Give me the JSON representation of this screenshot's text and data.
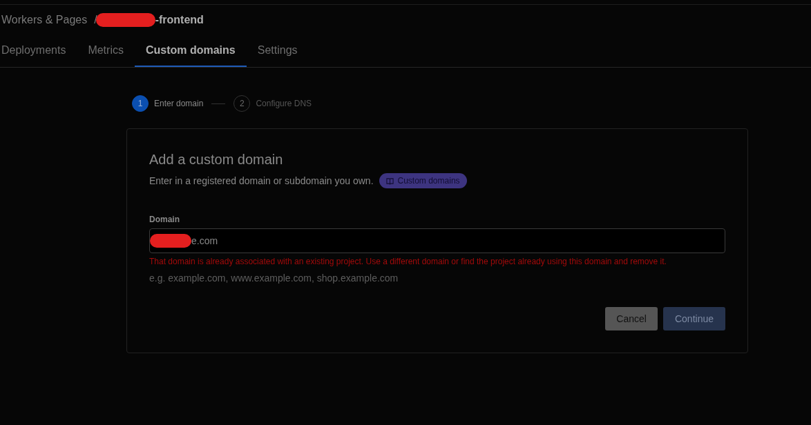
{
  "breadcrumb": {
    "root": "Workers & Pages",
    "separator": "/",
    "redacted": true,
    "current": "-frontend"
  },
  "tabs": [
    {
      "label": "Deployments",
      "selected": false
    },
    {
      "label": "Metrics",
      "selected": false
    },
    {
      "label": "Custom domains",
      "selected": true
    },
    {
      "label": "Settings",
      "selected": false
    }
  ],
  "steps": [
    {
      "number": "1",
      "label": "Enter domain",
      "selected": true
    },
    {
      "number": "2",
      "label": "Configure DNS",
      "selected": false
    }
  ],
  "card": {
    "title": "Add a custom domain",
    "description": "Enter in a registered domain or subdomain you own.",
    "doc_link": "Custom domains",
    "field": {
      "label": "Domain",
      "redacted": true,
      "value": "e.com",
      "error": "That domain is already associated with an existing project. Use a different domain or find the project already using this domain and remove it.",
      "hint": "e.g. example.com, www.example.com, shop.example.com"
    },
    "buttons": [
      {
        "label": "Cancel",
        "kind": "secondary"
      },
      {
        "label": "Continue",
        "kind": "primary"
      }
    ]
  }
}
